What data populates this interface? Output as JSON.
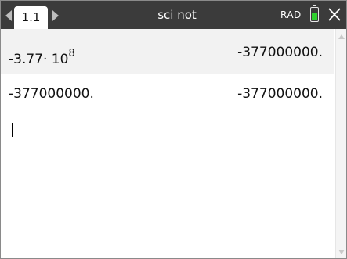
{
  "header": {
    "tab_label": "1.1",
    "document_title": "sci not",
    "angle_mode": "RAD"
  },
  "history": [
    {
      "input_mantissa": "-3.77· 10",
      "input_exponent": "8",
      "result": "-377000000."
    },
    {
      "input": "-377000000.",
      "result": "-377000000."
    }
  ],
  "icons": {
    "prev_page": "triangle-left-icon",
    "next_page": "triangle-right-icon",
    "battery": "battery-icon",
    "close": "close-icon",
    "scroll_up": "arrow-up-icon",
    "scroll_down": "arrow-down-icon"
  },
  "colors": {
    "titlebar": "#3b3b3b",
    "battery_fill": "#2fd12f",
    "shaded_row": "#f2f2f2"
  },
  "battery_level": 0.75
}
